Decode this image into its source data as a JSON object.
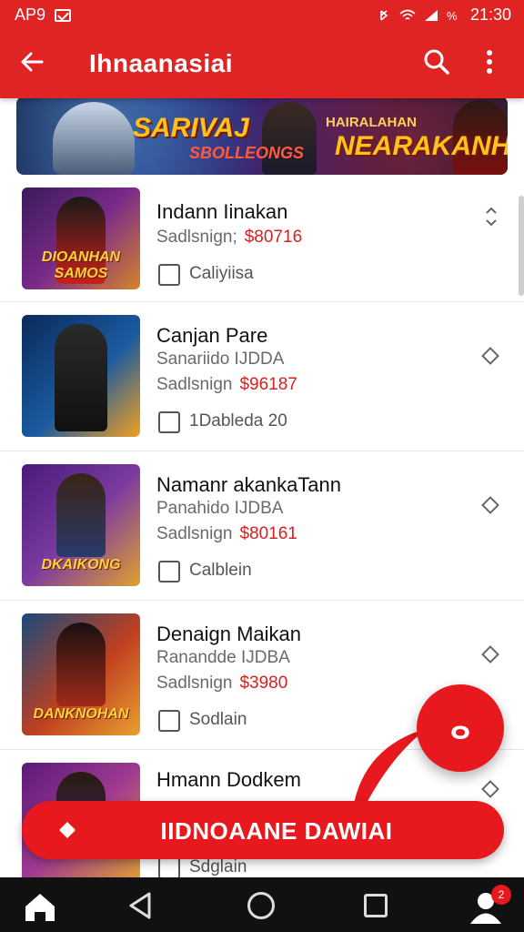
{
  "status_bar": {
    "left_label": "AP9",
    "time": "21:30"
  },
  "app_bar": {
    "title": "Ihnaanasiai"
  },
  "banner": {
    "text_main": "SARIVAJ",
    "text_sub": "SBOLLEONGS",
    "text_top_right": "HAIRALAHAN",
    "text_main_right": "NEARAKANH"
  },
  "items": [
    {
      "title": "Indann Iinakan",
      "subtitle": "",
      "price_label": "Sadlsnign;",
      "price": "$80716",
      "check_label": "Caliyiisa",
      "thumb_label": "DIOANHAN SAMOS",
      "action_icon": "expand-icon"
    },
    {
      "title": "Canjan Pare",
      "subtitle": "Sanariido IJDDA",
      "price_label": "Sadlsnign",
      "price": "$96187",
      "check_label": "1Dableda 20",
      "thumb_label": "",
      "action_icon": "diamond-icon"
    },
    {
      "title": "Namanr akankaTann",
      "subtitle": "Panahido IJDBA",
      "price_label": "Sadlsnign",
      "price": "$80161",
      "check_label": "Calblein",
      "thumb_label": "DKAIKONG",
      "action_icon": "diamond-icon"
    },
    {
      "title": "Denaign Maikan",
      "subtitle": "Ranandde IJDBA",
      "price_label": "Sadlsnign",
      "price": "$3980",
      "check_label": "Sodlain",
      "thumb_label": "DANKNOHAN",
      "action_icon": "diamond-icon"
    },
    {
      "title": "Hmann Dodkem",
      "subtitle": "",
      "price_label": "",
      "price": "",
      "check_label": "Sdglain",
      "thumb_label": "",
      "action_icon": "diamond-icon"
    }
  ],
  "fab": {
    "glyph": "ⴰ"
  },
  "cta": {
    "label": "IIDNOAANE DAWIAI"
  },
  "nav": {
    "profile_badge": "2"
  },
  "colors": {
    "primary": "#e02424",
    "accent_red": "#e8191e",
    "price_red": "#d72020",
    "navbar": "#111111"
  }
}
